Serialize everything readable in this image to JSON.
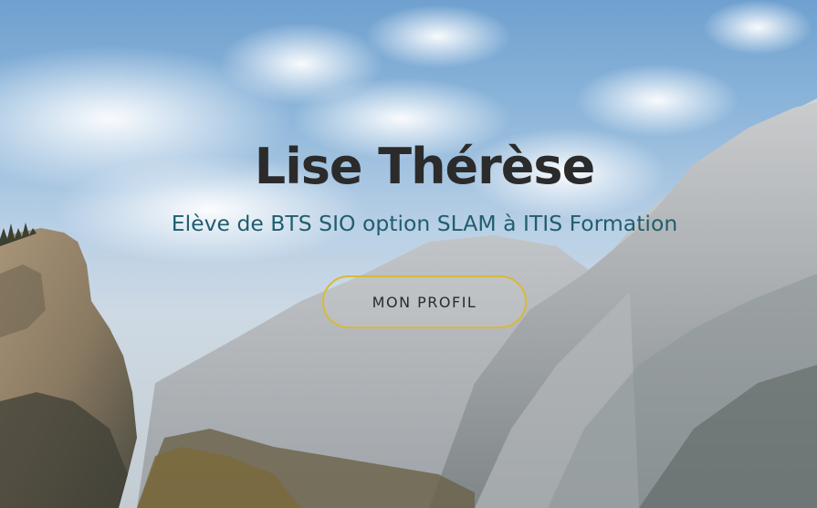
{
  "hero": {
    "title": "Lise Thérèse",
    "subtitle": "Elève de BTS SIO option SLAM à ITIS Formation",
    "button_label": "MON PROFIL"
  },
  "colors": {
    "title": "#2b2b2b",
    "subtitle": "#1f5e6e",
    "button_border": "#d8b939"
  }
}
